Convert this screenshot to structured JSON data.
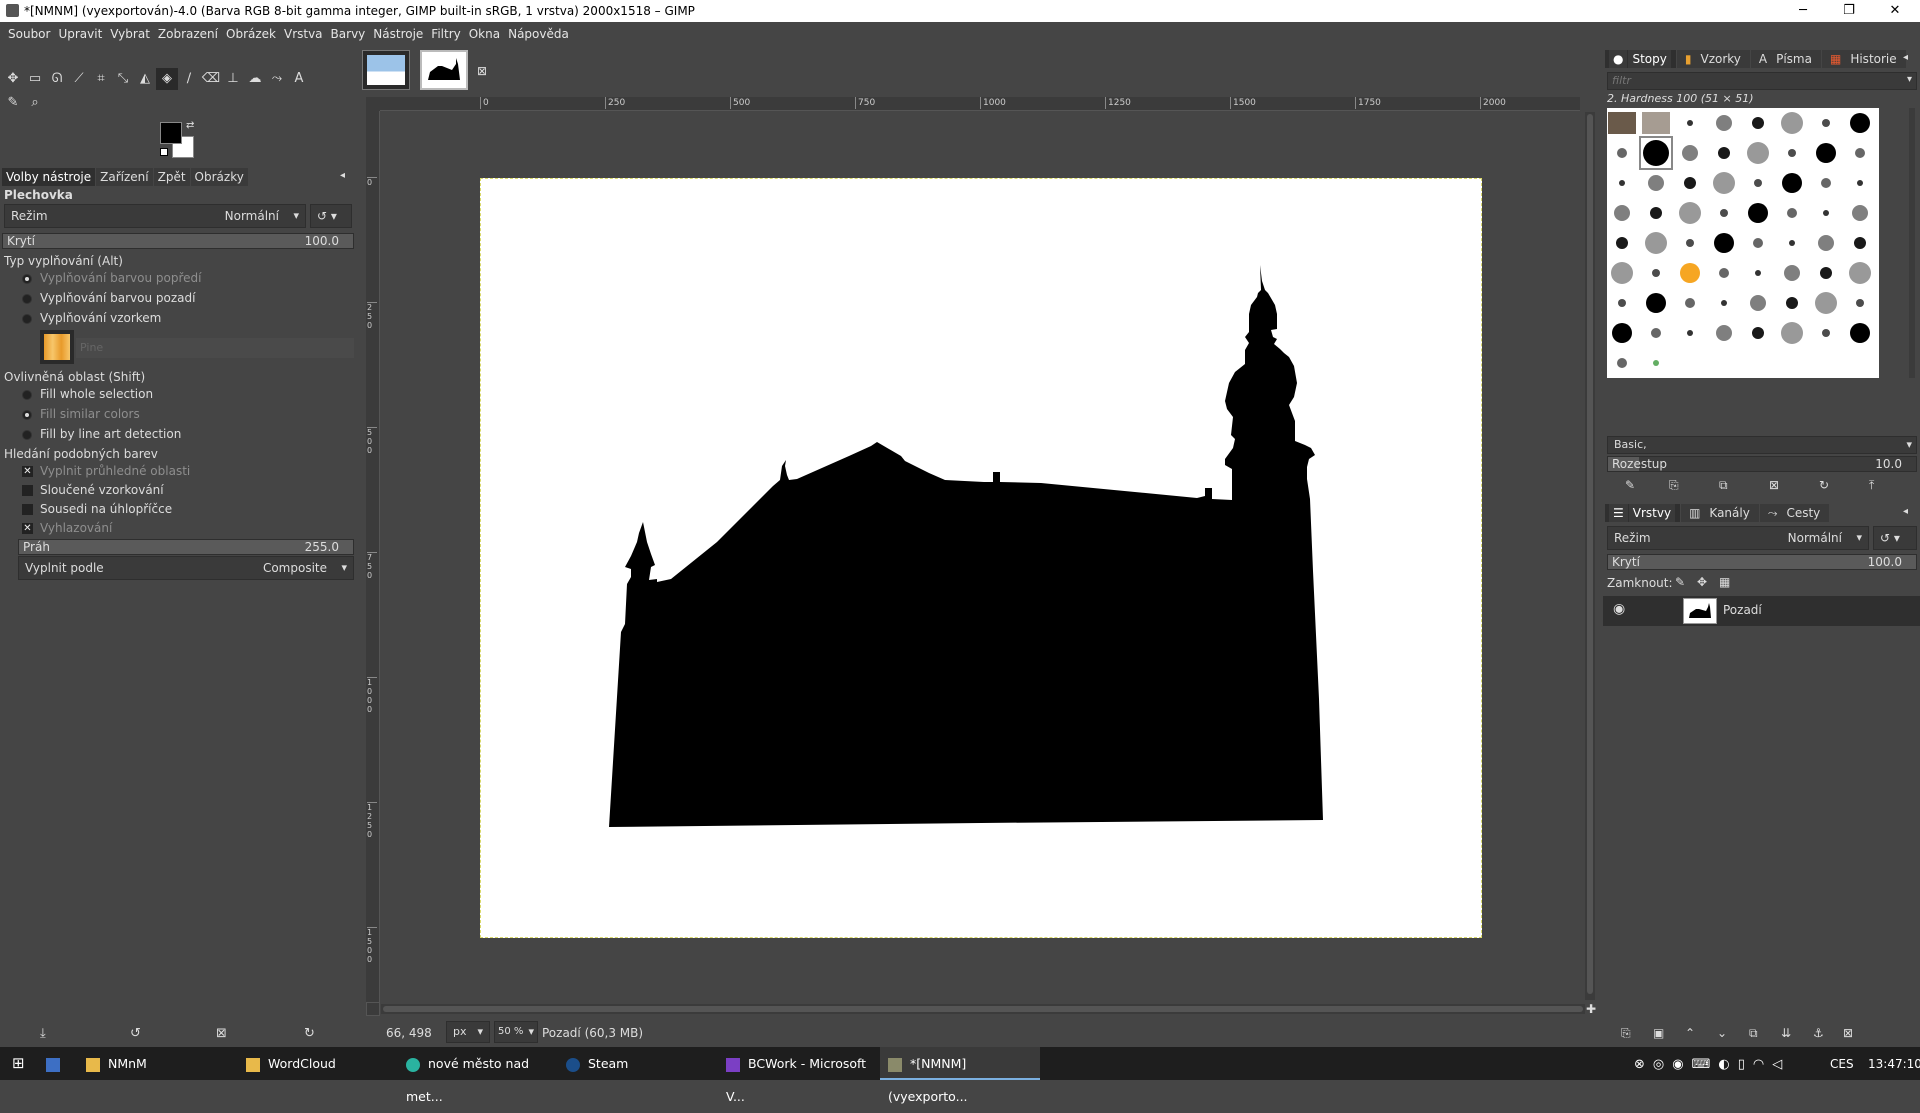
{
  "window": {
    "title": "*[NMNM] (vyexportován)-4.0 (Barva RGB 8-bit gamma integer, GIMP built-in sRGB, 1 vrstva) 2000x1518 – GIMP",
    "minimize": "─",
    "restore": "❐",
    "close": "✕"
  },
  "menu": [
    "Soubor",
    "Upravit",
    "Vybrat",
    "Zobrazení",
    "Obrázek",
    "Vrstva",
    "Barvy",
    "Nástroje",
    "Filtry",
    "Okna",
    "Nápověda"
  ],
  "tool_options": {
    "tabs": [
      "Volby nástroje",
      "Zařízení",
      "Zpět",
      "Obrázky"
    ],
    "tool_name": "Plechovka",
    "mode_label": "Režim",
    "mode_value": "Normální",
    "opacity_label": "Krytí",
    "opacity_value": "100.0",
    "fill_type_label": "Typ vyplňování  (Alt)",
    "fill_types": [
      "Vyplňování barvou popředí",
      "Vyplňování barvou pozadí",
      "Vyplňování vzorkem"
    ],
    "pattern_name": "Pine",
    "affected_label": "Ovlivněná oblast  (Shift)",
    "affected": [
      "Fill whole selection",
      "Fill similar colors",
      "Fill by line art detection"
    ],
    "similar_label": "Hledání podobných barev",
    "options": [
      "Vyplnit průhledné oblasti",
      "Sloučené vzorkování",
      "Sousedi na úhlopříčce",
      "Vyhlazování"
    ],
    "threshold_label": "Práh",
    "threshold_value": "255.0",
    "fill_by_label": "Vyplnit podle",
    "fill_by_value": "Composite"
  },
  "ruler": {
    "labels": [
      "0",
      "250",
      "500",
      "750",
      "1000",
      "1250",
      "1500",
      "1750",
      "2000"
    ]
  },
  "vruler": {
    "labels": [
      "0",
      "2 5 0",
      "5 0 0",
      "7 5 0",
      "1 0 0 0",
      "1 2 5 0",
      "1 5 0 0"
    ]
  },
  "status": {
    "coords": "66, 498",
    "unit": "px",
    "zoom": "50 %",
    "info": "Pozadí (60,3 MB)"
  },
  "brushes": {
    "tabs": [
      "Stopy",
      "Vzorky",
      "Písma",
      "Historie"
    ],
    "filter_placeholder": "filtr",
    "current": "2. Hardness 100 (51 × 51)",
    "preset": "Basic,",
    "spacing_label": "Rozestup",
    "spacing_value": "10.0"
  },
  "layers": {
    "tabs": [
      "Vrstvy",
      "Kanály",
      "Cesty"
    ],
    "mode_label": "Režim",
    "mode_value": "Normální",
    "opacity_label": "Krytí",
    "opacity_value": "100.0",
    "lock_label": "Zamknout:",
    "items": [
      {
        "name": "Pozadí"
      }
    ]
  },
  "taskbar": {
    "items": [
      "NMnM",
      "WordCloud",
      "nové město nad met...",
      "Steam",
      "BCWork - Microsoft V...",
      "*[NMNM] (vyexporto..."
    ],
    "lang": "CES",
    "time": "13:47:10"
  },
  "colors": {
    "fg": "#000000",
    "bg": "#ffffff",
    "accent": "#d9d96a"
  }
}
